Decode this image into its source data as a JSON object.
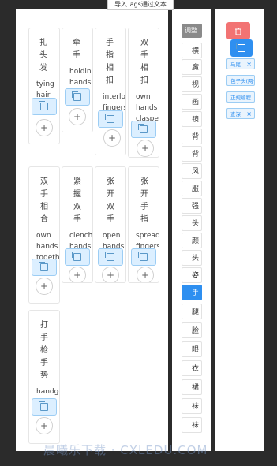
{
  "import_button": "导入Tags通过文本",
  "cards": [
    {
      "zh": "扎头发",
      "en": "tying hair"
    },
    {
      "zh": "牵手",
      "en": "holding hands"
    },
    {
      "zh": "手指相扣",
      "en": "interlocked fingers"
    },
    {
      "zh": "双手相扣",
      "en": "own hands clasped"
    },
    {
      "zh": "双手相合",
      "en": "own hands together"
    },
    {
      "zh": "紧握双手",
      "en": "clenched hands"
    },
    {
      "zh": "张开双手",
      "en": "open hands"
    },
    {
      "zh": "张开手指",
      "en": "spread fingers"
    },
    {
      "zh": "打手枪手势",
      "en": "handgestures"
    }
  ],
  "list_header": "调整",
  "list_items": [
    "横",
    "魔",
    "视",
    "画",
    "镜",
    "背",
    "背",
    "风",
    "服",
    "强",
    "头",
    "颜",
    "头",
    "姿",
    "手",
    "腿",
    "脸",
    "眼",
    "衣",
    "裙",
    "袜",
    "袜"
  ],
  "active_item": "手",
  "tags": [
    {
      "label": "马尾"
    },
    {
      "label": "包子头(两个)"
    },
    {
      "label": "正规编程"
    },
    {
      "label": "查深"
    }
  ],
  "watermark": "晨曦乐下载 · CXLEDU.COM",
  "icons": {
    "copy": "copy-icon",
    "plus": "plus-icon",
    "delete": "trash-icon",
    "close": "close-icon"
  }
}
